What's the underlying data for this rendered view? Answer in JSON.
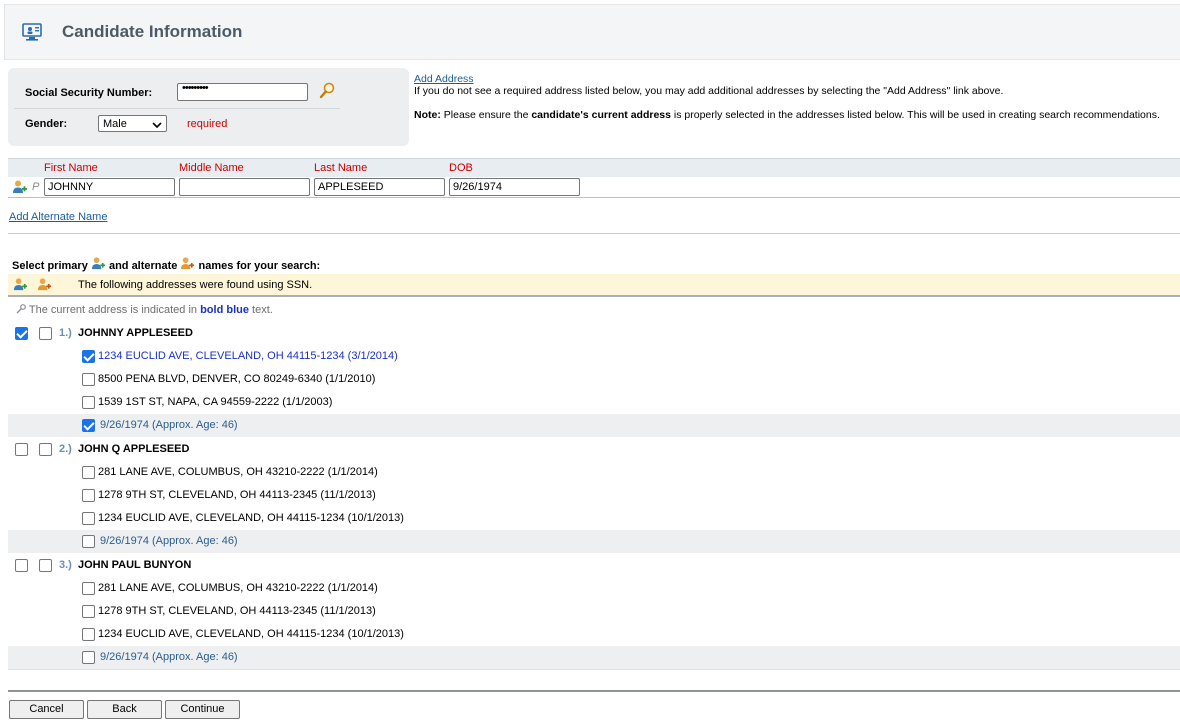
{
  "header": {
    "title": "Candidate Information",
    "icon": "monitor-person-icon"
  },
  "identity": {
    "ssn_label": "Social Security Number:",
    "ssn_value": "•••••••••",
    "gender_label": "Gender:",
    "gender_value": "Male",
    "required_text": "required"
  },
  "address_info": {
    "add_address_link": "Add Address",
    "hint": "If you do not see a required address listed below, you may add additional addresses by selecting the \"Add Address\" link above.",
    "note_label": "Note:",
    "note_pre": "Please ensure the",
    "note_bold": "candidate's current address",
    "note_post": "is properly selected in the addresses listed below. This will be used in creating search recommendations."
  },
  "name_table": {
    "headers": {
      "first": "First Name",
      "middle": "Middle Name",
      "last": "Last Name",
      "dob": "DOB"
    },
    "row": {
      "marker": "P",
      "first": "JOHNNY",
      "middle": "",
      "last": "APPLESEED",
      "dob": "9/26/1974"
    }
  },
  "add_alternate_name": "Add Alternate Name",
  "select_label": {
    "part1": "Select primary",
    "part2": "and alternate",
    "part3": "names for your search:"
  },
  "banner_message": "The following addresses were found using SSN.",
  "current_note": {
    "pre": "The current address is indicated in",
    "bold": "bold blue",
    "post": "text."
  },
  "candidates": [
    {
      "number": "1.)",
      "name": "JOHNNY APPLESEED",
      "primary": true,
      "alternate": false,
      "addresses": [
        {
          "text": "1234 EUCLID AVE, CLEVELAND, OH 44115-1234 (3/1/2014)",
          "checked": true,
          "current": true
        },
        {
          "text": "8500 PENA BLVD, DENVER, CO 80249-6340 (1/1/2010)",
          "checked": false,
          "current": false
        },
        {
          "text": "1539 1ST ST, NAPA, CA 94559-2222 (1/1/2003)",
          "checked": false,
          "current": false
        }
      ],
      "dob": {
        "text": "9/26/1974 (Approx. Age: 46)",
        "checked": true
      }
    },
    {
      "number": "2.)",
      "name": "JOHN Q APPLESEED",
      "primary": false,
      "alternate": false,
      "addresses": [
        {
          "text": "281 LANE AVE, COLUMBUS, OH 43210-2222 (1/1/2014)",
          "checked": false,
          "current": false
        },
        {
          "text": "1278 9TH ST, CLEVELAND, OH 44113-2345 (11/1/2013)",
          "checked": false,
          "current": false
        },
        {
          "text": "1234 EUCLID AVE, CLEVELAND, OH 44115-1234 (10/1/2013)",
          "checked": false,
          "current": false
        }
      ],
      "dob": {
        "text": "9/26/1974 (Approx. Age: 46)",
        "checked": false
      }
    },
    {
      "number": "3.)",
      "name": "JOHN PAUL BUNYON",
      "primary": false,
      "alternate": false,
      "addresses": [
        {
          "text": "281 LANE AVE, COLUMBUS, OH 43210-2222 (1/1/2014)",
          "checked": false,
          "current": false
        },
        {
          "text": "1278 9TH ST, CLEVELAND, OH 44113-2345 (11/1/2013)",
          "checked": false,
          "current": false
        },
        {
          "text": "1234 EUCLID AVE, CLEVELAND, OH 44115-1234 (10/1/2013)",
          "checked": false,
          "current": false
        }
      ],
      "dob": {
        "text": "9/26/1974 (Approx. Age: 46)",
        "checked": false
      }
    }
  ],
  "buttons": {
    "cancel": "Cancel",
    "back": "Back",
    "continue": "Continue"
  },
  "colors": {
    "current_address": "#1b2fc9",
    "required": "#cc0000",
    "checkbox_checked": "#1a73e8",
    "dob_text": "#2a5d8f"
  }
}
